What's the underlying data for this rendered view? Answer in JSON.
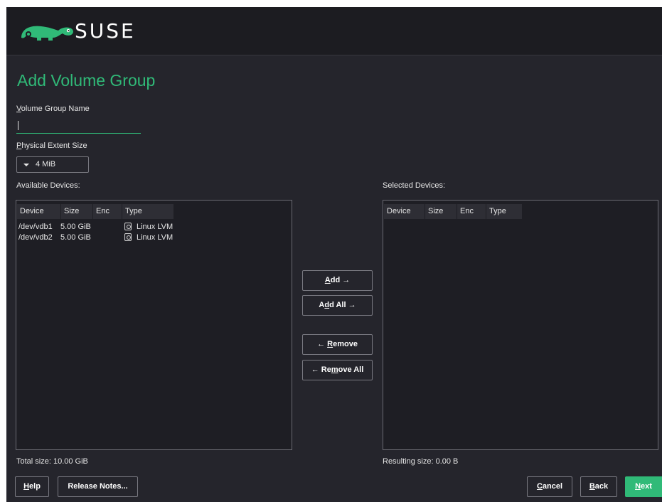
{
  "header": {
    "brand": "SUSE",
    "logo_icon": "chameleon-logo",
    "brand_color": "#30ba78"
  },
  "page": {
    "title": "Add Volume Group"
  },
  "vg_name": {
    "label": "Volume Group Name",
    "label_ul": "V",
    "label_rest": "olume Group Name",
    "value": ""
  },
  "extent": {
    "label": "Physical Extent Size",
    "label_ul": "P",
    "label_rest": "hysical Extent Size",
    "selected": "4 MiB"
  },
  "available": {
    "label": "Available Devices:",
    "columns": [
      "Device",
      "Size",
      "Enc",
      "Type"
    ],
    "rows": [
      {
        "device": "/dev/vdb1",
        "size": "5.00 GiB",
        "enc": "",
        "type": "Linux LVM",
        "type_icon": "disk-icon"
      },
      {
        "device": "/dev/vdb2",
        "size": "5.00 GiB",
        "enc": "",
        "type": "Linux LVM",
        "type_icon": "disk-icon"
      }
    ],
    "total": "Total size: 10.00 GiB"
  },
  "selected": {
    "label": "Selected Devices:",
    "columns": [
      "Device",
      "Size",
      "Enc",
      "Type"
    ],
    "rows": [],
    "total": "Resulting size: 0.00 B"
  },
  "move_buttons": {
    "add": {
      "ul": "A",
      "rest": "dd →"
    },
    "add_all": {
      "pre": "A",
      "ul": "d",
      "rest": "d All →"
    },
    "remove": {
      "pre": "← ",
      "ul": "R",
      "rest": "emove"
    },
    "remove_all": {
      "pre": "← Re",
      "ul": "m",
      "rest": "ove All"
    }
  },
  "footer": {
    "help": {
      "ul": "H",
      "rest": "elp"
    },
    "release_notes": "Release Notes...",
    "cancel": {
      "ul": "C",
      "rest": "ancel"
    },
    "back": {
      "ul": "B",
      "rest": "ack"
    },
    "next": {
      "ul": "N",
      "rest": "ext"
    }
  }
}
